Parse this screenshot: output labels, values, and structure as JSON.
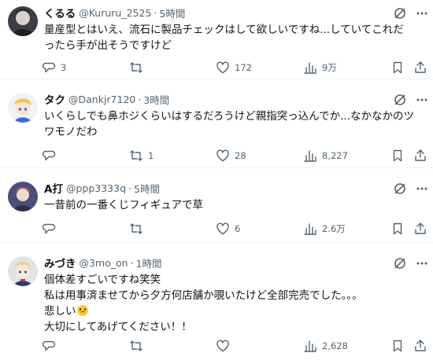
{
  "posts": [
    {
      "name": "くるる",
      "handle": "@Kururu_2525",
      "separator": "·",
      "time": "5時間",
      "lines": [
        "量産型とはいえ、流石に製品チェックはして欲しいですね...していてこれだ",
        "ったら手が出そうですけど"
      ],
      "reply_count": "3",
      "repost_count": "",
      "like_count": "172",
      "view_count": "9万"
    },
    {
      "name": "タク",
      "handle": "@Dankjr7120",
      "separator": "·",
      "time": "3時間",
      "lines": [
        "いくらしでも鼻ホジくらいはするだろうけど親指突っ込んでか...なかなかのツ",
        "ワモノだわ"
      ],
      "reply_count": "",
      "repost_count": "1",
      "like_count": "28",
      "view_count": "8,227"
    },
    {
      "name": "A打",
      "handle": "@ppp3333q",
      "separator": "·",
      "time": "5時間",
      "lines": [
        "一昔前の一番くじフィギュアで草"
      ],
      "reply_count": "",
      "repost_count": "",
      "like_count": "6",
      "view_count": "2.6万"
    },
    {
      "name": "みづき",
      "handle": "@3mo_on",
      "separator": "·",
      "time": "1時間",
      "lines": [
        "個体差すごいですね笑笑",
        "私は用事済ませてから夕方何店舗か覗いたけど全部完売でした。。。",
        "悲しい",
        "大切にしてあげてください！！"
      ],
      "emoji": "pleading-face-emoji",
      "reply_count": "",
      "repost_count": "",
      "like_count": "",
      "view_count": "2,628"
    }
  ],
  "icons": {
    "reply": "reply-icon",
    "repost": "repost-icon",
    "like": "like-icon",
    "views": "views-icon",
    "bookmark": "bookmark-icon",
    "share": "share-icon",
    "grok": "grok-icon",
    "more": "more-icon"
  },
  "colors": {
    "text": "#0f1419",
    "secondary": "#536471",
    "divider": "#eff3f4"
  }
}
